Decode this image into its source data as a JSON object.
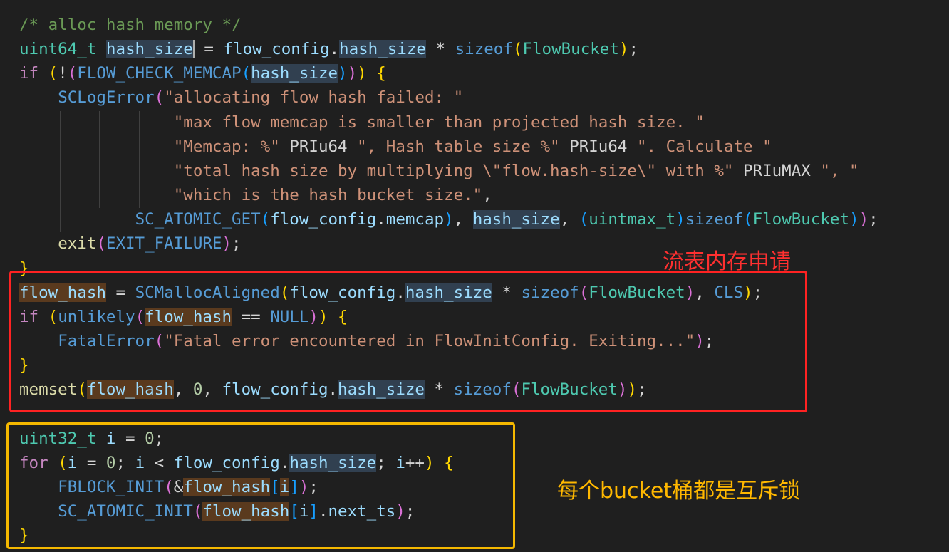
{
  "colors": {
    "background": "#1f1f1f",
    "red_box": "#ff2222",
    "yellow_box": "#f5b800",
    "red_note": "#ff3030",
    "yellow_note": "#ffb800"
  },
  "code_lines": [
    {
      "tokens": [
        {
          "t": "/* alloc hash memory */",
          "c": "cmt"
        }
      ]
    },
    {
      "tokens": [
        {
          "t": "uint64_t",
          "c": "type"
        },
        {
          "t": " ",
          "c": "p"
        },
        {
          "t": "hash_size",
          "c": "var hl cursor"
        },
        {
          "t": " = ",
          "c": "p"
        },
        {
          "t": "flow_config",
          "c": "var"
        },
        {
          "t": ".",
          "c": "p"
        },
        {
          "t": "hash_size",
          "c": "var hl"
        },
        {
          "t": " * ",
          "c": "p"
        },
        {
          "t": "sizeof",
          "c": "kw"
        },
        {
          "t": "(",
          "c": "b1"
        },
        {
          "t": "FlowBucket",
          "c": "type"
        },
        {
          "t": ")",
          "c": "b1"
        },
        {
          "t": ";",
          "c": "p"
        }
      ]
    },
    {
      "tokens": [
        {
          "t": "if",
          "c": "ctrl"
        },
        {
          "t": " ",
          "c": "p"
        },
        {
          "t": "(",
          "c": "b1"
        },
        {
          "t": "!",
          "c": "p"
        },
        {
          "t": "(",
          "c": "b2"
        },
        {
          "t": "FLOW_CHECK_MEMCAP",
          "c": "macro"
        },
        {
          "t": "(",
          "c": "b3"
        },
        {
          "t": "hash_size",
          "c": "var hl"
        },
        {
          "t": ")",
          "c": "b3"
        },
        {
          "t": ")",
          "c": "b2"
        },
        {
          "t": ")",
          "c": "b1"
        },
        {
          "t": " ",
          "c": "p"
        },
        {
          "t": "{",
          "c": "b1"
        }
      ]
    },
    {
      "tokens": [
        {
          "t": "    ",
          "c": "p"
        },
        {
          "t": "SCLogError",
          "c": "macro"
        },
        {
          "t": "(",
          "c": "b2"
        },
        {
          "t": "\"allocating flow hash failed: \"",
          "c": "str"
        }
      ]
    },
    {
      "tokens": [
        {
          "t": "                ",
          "c": "p"
        },
        {
          "t": "\"max flow memcap is smaller than projected hash size. \"",
          "c": "str"
        }
      ]
    },
    {
      "tokens": [
        {
          "t": "                ",
          "c": "p"
        },
        {
          "t": "\"Memcap: %\"",
          "c": "str"
        },
        {
          "t": " PRIu64 ",
          "c": "p"
        },
        {
          "t": "\", Hash table size %\"",
          "c": "str"
        },
        {
          "t": " PRIu64 ",
          "c": "p"
        },
        {
          "t": "\". Calculate \"",
          "c": "str"
        }
      ]
    },
    {
      "tokens": [
        {
          "t": "                ",
          "c": "p"
        },
        {
          "t": "\"total hash size by multiplying \\\"flow.hash-size\\\" with %\"",
          "c": "str"
        },
        {
          "t": " PRIuMAX ",
          "c": "p"
        },
        {
          "t": "\", \"",
          "c": "str"
        }
      ]
    },
    {
      "tokens": [
        {
          "t": "                ",
          "c": "p"
        },
        {
          "t": "\"which is the hash bucket size.\"",
          "c": "str"
        },
        {
          "t": ",",
          "c": "p"
        }
      ]
    },
    {
      "tokens": [
        {
          "t": "            ",
          "c": "p"
        },
        {
          "t": "SC_ATOMIC_GET",
          "c": "macro"
        },
        {
          "t": "(",
          "c": "b3"
        },
        {
          "t": "flow_config",
          "c": "var"
        },
        {
          "t": ".",
          "c": "p"
        },
        {
          "t": "memcap",
          "c": "var"
        },
        {
          "t": ")",
          "c": "b3"
        },
        {
          "t": ", ",
          "c": "p"
        },
        {
          "t": "hash_size",
          "c": "var hl"
        },
        {
          "t": ", ",
          "c": "p"
        },
        {
          "t": "(",
          "c": "b3"
        },
        {
          "t": "uintmax_t",
          "c": "type"
        },
        {
          "t": ")",
          "c": "b3"
        },
        {
          "t": "sizeof",
          "c": "kw"
        },
        {
          "t": "(",
          "c": "b3"
        },
        {
          "t": "FlowBucket",
          "c": "type"
        },
        {
          "t": ")",
          "c": "b3"
        },
        {
          "t": ")",
          "c": "b2"
        },
        {
          "t": ";",
          "c": "p"
        }
      ]
    },
    {
      "tokens": [
        {
          "t": "    ",
          "c": "p"
        },
        {
          "t": "exit",
          "c": "fn"
        },
        {
          "t": "(",
          "c": "b2"
        },
        {
          "t": "EXIT_FAILURE",
          "c": "macro"
        },
        {
          "t": ")",
          "c": "b2"
        },
        {
          "t": ";",
          "c": "p"
        }
      ]
    },
    {
      "tokens": [
        {
          "t": "}",
          "c": "b1"
        }
      ]
    },
    {
      "tokens": [
        {
          "t": "flow_hash",
          "c": "var hlw"
        },
        {
          "t": " = ",
          "c": "p"
        },
        {
          "t": "SCMallocAligned",
          "c": "macro"
        },
        {
          "t": "(",
          "c": "b1"
        },
        {
          "t": "flow_config",
          "c": "var"
        },
        {
          "t": ".",
          "c": "p"
        },
        {
          "t": "hash_size",
          "c": "var hl"
        },
        {
          "t": " * ",
          "c": "p"
        },
        {
          "t": "sizeof",
          "c": "kw"
        },
        {
          "t": "(",
          "c": "b2"
        },
        {
          "t": "FlowBucket",
          "c": "type"
        },
        {
          "t": ")",
          "c": "b2"
        },
        {
          "t": ", ",
          "c": "p"
        },
        {
          "t": "CLS",
          "c": "macro"
        },
        {
          "t": ")",
          "c": "b1"
        },
        {
          "t": ";",
          "c": "p"
        }
      ]
    },
    {
      "tokens": [
        {
          "t": "if",
          "c": "ctrl"
        },
        {
          "t": " ",
          "c": "p"
        },
        {
          "t": "(",
          "c": "b1"
        },
        {
          "t": "unlikely",
          "c": "macro"
        },
        {
          "t": "(",
          "c": "b2"
        },
        {
          "t": "flow_hash",
          "c": "var hlw"
        },
        {
          "t": " == ",
          "c": "p"
        },
        {
          "t": "NULL",
          "c": "macro"
        },
        {
          "t": ")",
          "c": "b2"
        },
        {
          "t": ")",
          "c": "b1"
        },
        {
          "t": " ",
          "c": "p"
        },
        {
          "t": "{",
          "c": "b1"
        }
      ]
    },
    {
      "tokens": [
        {
          "t": "    ",
          "c": "p"
        },
        {
          "t": "FatalError",
          "c": "macro"
        },
        {
          "t": "(",
          "c": "b2"
        },
        {
          "t": "\"Fatal error encountered in FlowInitConfig. Exiting...\"",
          "c": "str"
        },
        {
          "t": ")",
          "c": "b2"
        },
        {
          "t": ";",
          "c": "p"
        }
      ]
    },
    {
      "tokens": [
        {
          "t": "}",
          "c": "b1"
        }
      ]
    },
    {
      "tokens": [
        {
          "t": "memset",
          "c": "fn"
        },
        {
          "t": "(",
          "c": "b1"
        },
        {
          "t": "flow_hash",
          "c": "var hlw"
        },
        {
          "t": ", ",
          "c": "p"
        },
        {
          "t": "0",
          "c": "num"
        },
        {
          "t": ", ",
          "c": "p"
        },
        {
          "t": "flow_config",
          "c": "var"
        },
        {
          "t": ".",
          "c": "p"
        },
        {
          "t": "hash_size",
          "c": "var hl"
        },
        {
          "t": " * ",
          "c": "p"
        },
        {
          "t": "sizeof",
          "c": "kw"
        },
        {
          "t": "(",
          "c": "b2"
        },
        {
          "t": "FlowBucket",
          "c": "type"
        },
        {
          "t": ")",
          "c": "b2"
        },
        {
          "t": ")",
          "c": "b1"
        },
        {
          "t": ";",
          "c": "p"
        }
      ]
    },
    {
      "tokens": []
    },
    {
      "tokens": [
        {
          "t": "uint32_t",
          "c": "type"
        },
        {
          "t": " ",
          "c": "p"
        },
        {
          "t": "i",
          "c": "var"
        },
        {
          "t": " = ",
          "c": "p"
        },
        {
          "t": "0",
          "c": "num"
        },
        {
          "t": ";",
          "c": "p"
        }
      ]
    },
    {
      "tokens": [
        {
          "t": "for",
          "c": "ctrl"
        },
        {
          "t": " ",
          "c": "p"
        },
        {
          "t": "(",
          "c": "b1"
        },
        {
          "t": "i",
          "c": "var"
        },
        {
          "t": " = ",
          "c": "p"
        },
        {
          "t": "0",
          "c": "num"
        },
        {
          "t": "; ",
          "c": "p"
        },
        {
          "t": "i",
          "c": "var"
        },
        {
          "t": " < ",
          "c": "p"
        },
        {
          "t": "flow_config",
          "c": "var"
        },
        {
          "t": ".",
          "c": "p"
        },
        {
          "t": "hash_size",
          "c": "var hl"
        },
        {
          "t": "; ",
          "c": "p"
        },
        {
          "t": "i",
          "c": "var"
        },
        {
          "t": "++",
          "c": "p"
        },
        {
          "t": ")",
          "c": "b1"
        },
        {
          "t": " ",
          "c": "p"
        },
        {
          "t": "{",
          "c": "b1"
        }
      ]
    },
    {
      "tokens": [
        {
          "t": "    ",
          "c": "p"
        },
        {
          "t": "FBLOCK_INIT",
          "c": "macro"
        },
        {
          "t": "(",
          "c": "b2"
        },
        {
          "t": "&",
          "c": "p"
        },
        {
          "t": "flow_hash",
          "c": "var hlw"
        },
        {
          "t": "[",
          "c": "b3"
        },
        {
          "t": "i",
          "c": "var hlw"
        },
        {
          "t": "]",
          "c": "b3"
        },
        {
          "t": ")",
          "c": "b2"
        },
        {
          "t": ";",
          "c": "p"
        }
      ]
    },
    {
      "tokens": [
        {
          "t": "    ",
          "c": "p"
        },
        {
          "t": "SC_ATOMIC_INIT",
          "c": "macro"
        },
        {
          "t": "(",
          "c": "b2"
        },
        {
          "t": "flow_hash",
          "c": "var hlw"
        },
        {
          "t": "[",
          "c": "b3"
        },
        {
          "t": "i",
          "c": "var"
        },
        {
          "t": "]",
          "c": "b3"
        },
        {
          "t": ".",
          "c": "p"
        },
        {
          "t": "next_ts",
          "c": "var"
        },
        {
          "t": ")",
          "c": "b2"
        },
        {
          "t": ";",
          "c": "p"
        }
      ]
    },
    {
      "tokens": [
        {
          "t": "}",
          "c": "b1"
        }
      ]
    }
  ],
  "annotations": {
    "red_label": "流表内存申请",
    "yellow_label": "每个bucket桶都是互斥锁"
  }
}
